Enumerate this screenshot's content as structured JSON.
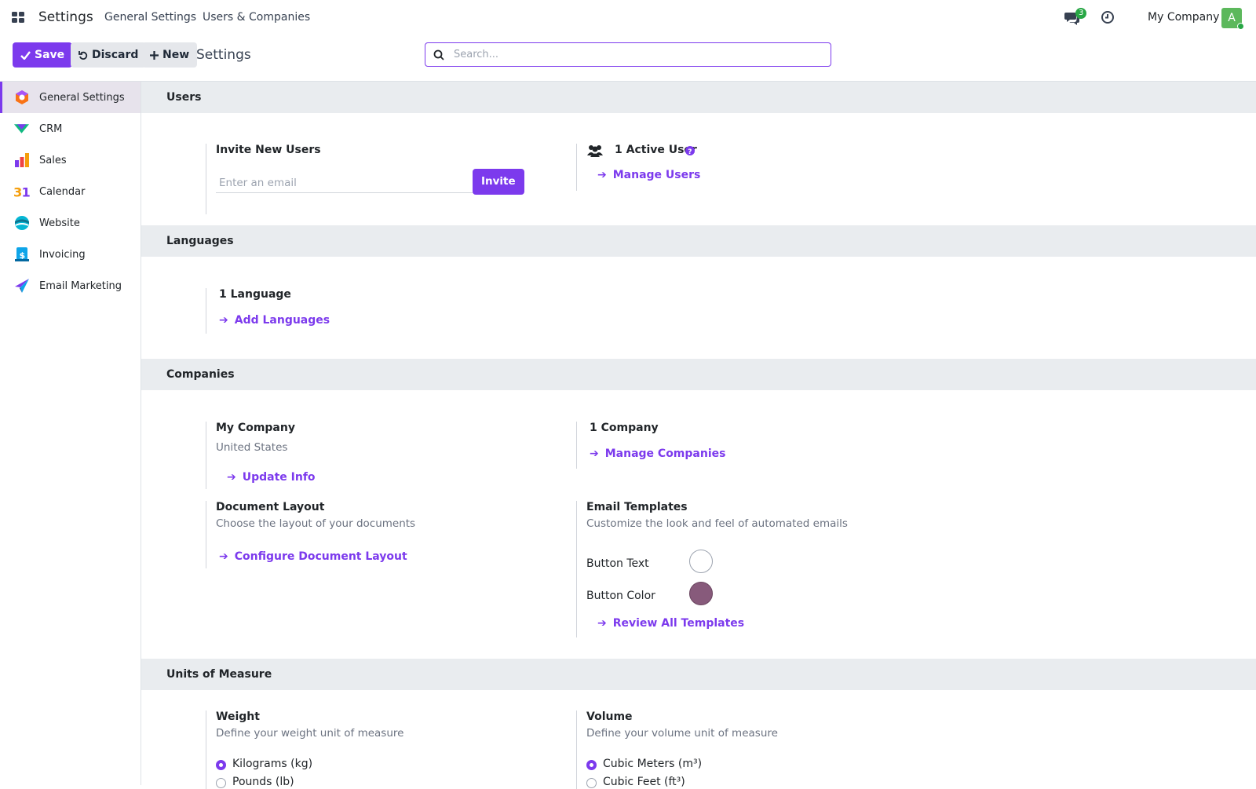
{
  "topbar": {
    "app_name": "Settings",
    "nav": [
      "General Settings",
      "Users & Companies"
    ],
    "chat_count": "3",
    "company": "My Company",
    "avatar_letter": "A"
  },
  "controls": {
    "save": "Save",
    "discard": "Discard",
    "new": "New",
    "title": "Settings",
    "search_placeholder": "Search..."
  },
  "sidebar": {
    "items": [
      {
        "label": "General Settings",
        "icon": "general-settings-icon"
      },
      {
        "label": "CRM",
        "icon": "crm-icon"
      },
      {
        "label": "Sales",
        "icon": "sales-icon"
      },
      {
        "label": "Calendar",
        "icon": "calendar-icon"
      },
      {
        "label": "Website",
        "icon": "website-icon"
      },
      {
        "label": "Invoicing",
        "icon": "invoicing-icon"
      },
      {
        "label": "Email Marketing",
        "icon": "email-marketing-icon"
      }
    ]
  },
  "users": {
    "heading": "Users",
    "invite_label": "Invite New Users",
    "email_placeholder": "Enter an email",
    "invite_button": "Invite",
    "active_users": "1 Active User",
    "manage_users": "Manage Users"
  },
  "languages": {
    "heading": "Languages",
    "count": "1 Language",
    "add": "Add Languages"
  },
  "companies": {
    "heading": "Companies",
    "company_name": "My Company",
    "country": "United States",
    "update": "Update Info",
    "count": "1 Company",
    "manage": "Manage Companies",
    "doc_layout_title": "Document Layout",
    "doc_layout_desc": "Choose the layout of your documents",
    "doc_layout_link": "Configure Document Layout",
    "email_templates_title": "Email Templates",
    "email_templates_desc": "Customize the look and feel of automated emails",
    "button_text_label": "Button Text",
    "button_color_label": "Button Color",
    "review_templates": "Review All Templates",
    "button_text_color": "#ffffff",
    "button_color": "#875a7b"
  },
  "uom": {
    "heading": "Units of Measure",
    "weight_title": "Weight",
    "weight_desc": "Define your weight unit of measure",
    "weight_options": [
      "Kilograms (kg)",
      "Pounds (lb)"
    ],
    "volume_title": "Volume",
    "volume_desc": "Define your volume unit of measure",
    "volume_options": [
      "Cubic Meters (m³)",
      "Cubic Feet (ft³)"
    ]
  },
  "colors": {
    "accent": "#7c3aed"
  }
}
